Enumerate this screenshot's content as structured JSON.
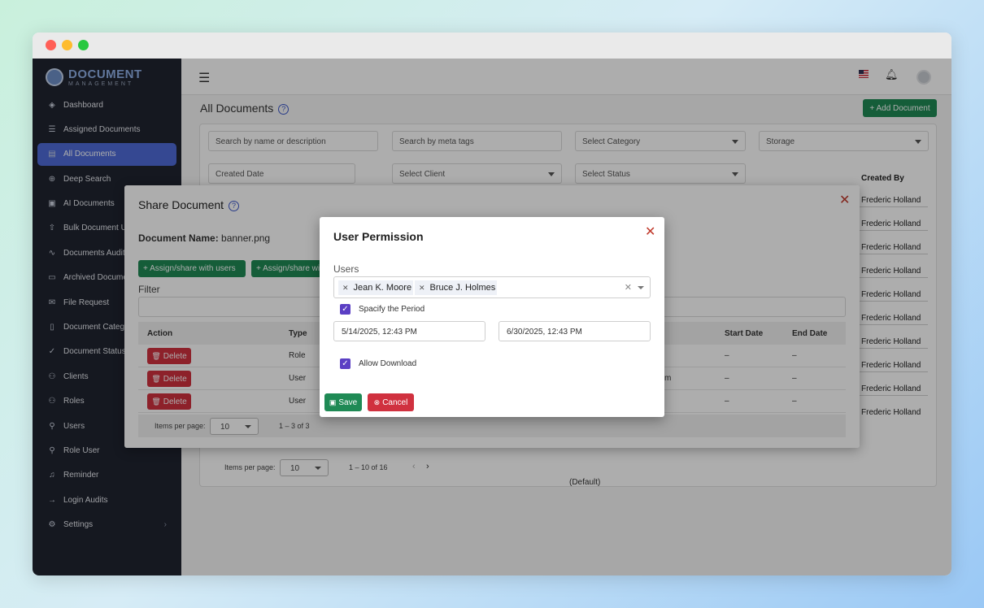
{
  "app": {
    "logo_title": "DOCUMENT",
    "logo_subtitle": "MANAGEMENT"
  },
  "sidebar": {
    "items": [
      {
        "label": "Dashboard",
        "icon": "layers-icon"
      },
      {
        "label": "Assigned Documents",
        "icon": "list-icon"
      },
      {
        "label": "All Documents",
        "icon": "file-icon",
        "active": true
      },
      {
        "label": "Deep Search",
        "icon": "search-plus-icon"
      },
      {
        "label": "AI Documents",
        "icon": "chip-icon"
      },
      {
        "label": "Bulk Document Upload",
        "icon": "upload-icon"
      },
      {
        "label": "Documents Audit Trail",
        "icon": "activity-icon"
      },
      {
        "label": "Archived Documents",
        "icon": "archive-icon"
      },
      {
        "label": "File Request",
        "icon": "mail-icon"
      },
      {
        "label": "Document Categories",
        "icon": "file-icon"
      },
      {
        "label": "Document Status",
        "icon": "check-icon"
      },
      {
        "label": "Clients",
        "icon": "users-icon"
      },
      {
        "label": "Roles",
        "icon": "users-icon"
      },
      {
        "label": "Users",
        "icon": "user-icon"
      },
      {
        "label": "Role User",
        "icon": "user-check-icon"
      },
      {
        "label": "Reminder",
        "icon": "bell-icon"
      },
      {
        "label": "Login Audits",
        "icon": "login-icon"
      },
      {
        "label": "Settings",
        "icon": "gear-icon",
        "chevron": "›"
      }
    ]
  },
  "page": {
    "title": "All Documents",
    "help": "?",
    "add_button": "+ Add Document"
  },
  "filters": {
    "search_name": "Search by name or description",
    "search_tags": "Search by meta tags",
    "category": "Select Category",
    "storage": "Storage",
    "created_date": "Created Date",
    "client": "Select Client",
    "status": "Select Status"
  },
  "background_table": {
    "created_by_header": "Created By",
    "created_by": [
      "Frederic Holland",
      "Frederic Holland",
      "Frederic Holland",
      "Frederic Holland",
      "Frederic Holland",
      "Frederic Holland",
      "Frederic Holland",
      "Frederic Holland",
      "Frederic Holland",
      "Frederic Holland"
    ],
    "default_text": "(Default)",
    "items_per_page_label": "Items per page:",
    "items_per_page": "10",
    "range": "1 – 10 of 16"
  },
  "share_dialog": {
    "title": "Share Document",
    "doc_name_label": "Document Name:",
    "doc_name": "banner.png",
    "assign_users": "+ Assign/share with users",
    "assign_roles": "+ Assign/share with roles",
    "filter_label": "Filter",
    "columns": [
      "Action",
      "Type",
      "Start Date",
      "End Date"
    ],
    "rows": [
      {
        "action": "Delete",
        "type": "Role",
        "extra": "",
        "start": "–",
        "end": "–"
      },
      {
        "action": "Delete",
        "type": "User",
        "extra": "m",
        "start": "–",
        "end": "–"
      },
      {
        "action": "Delete",
        "type": "User",
        "extra": "",
        "start": "–",
        "end": "–"
      }
    ],
    "items_per_page_label": "Items per page:",
    "items_per_page": "10",
    "range": "1 – 3 of 3"
  },
  "permission_dialog": {
    "title": "User Permission",
    "users_label": "Users",
    "users": [
      "Jean K. Moore",
      "Bruce J. Holmes"
    ],
    "specify_period_label": "Spacify the Period",
    "specify_period_checked": true,
    "start_date": "5/14/2025, 12:43 PM",
    "end_date": "6/30/2025, 12:43 PM",
    "allow_download_label": "Allow Download",
    "allow_download_checked": true,
    "save": "Save",
    "cancel": "Cancel"
  },
  "colors": {
    "sidebar_bg": "#1f2430",
    "active_nav": "#4e6bd7",
    "primary_green": "#1f8a55",
    "danger_red": "#d0313f",
    "checkbox": "#5b3fc4"
  }
}
